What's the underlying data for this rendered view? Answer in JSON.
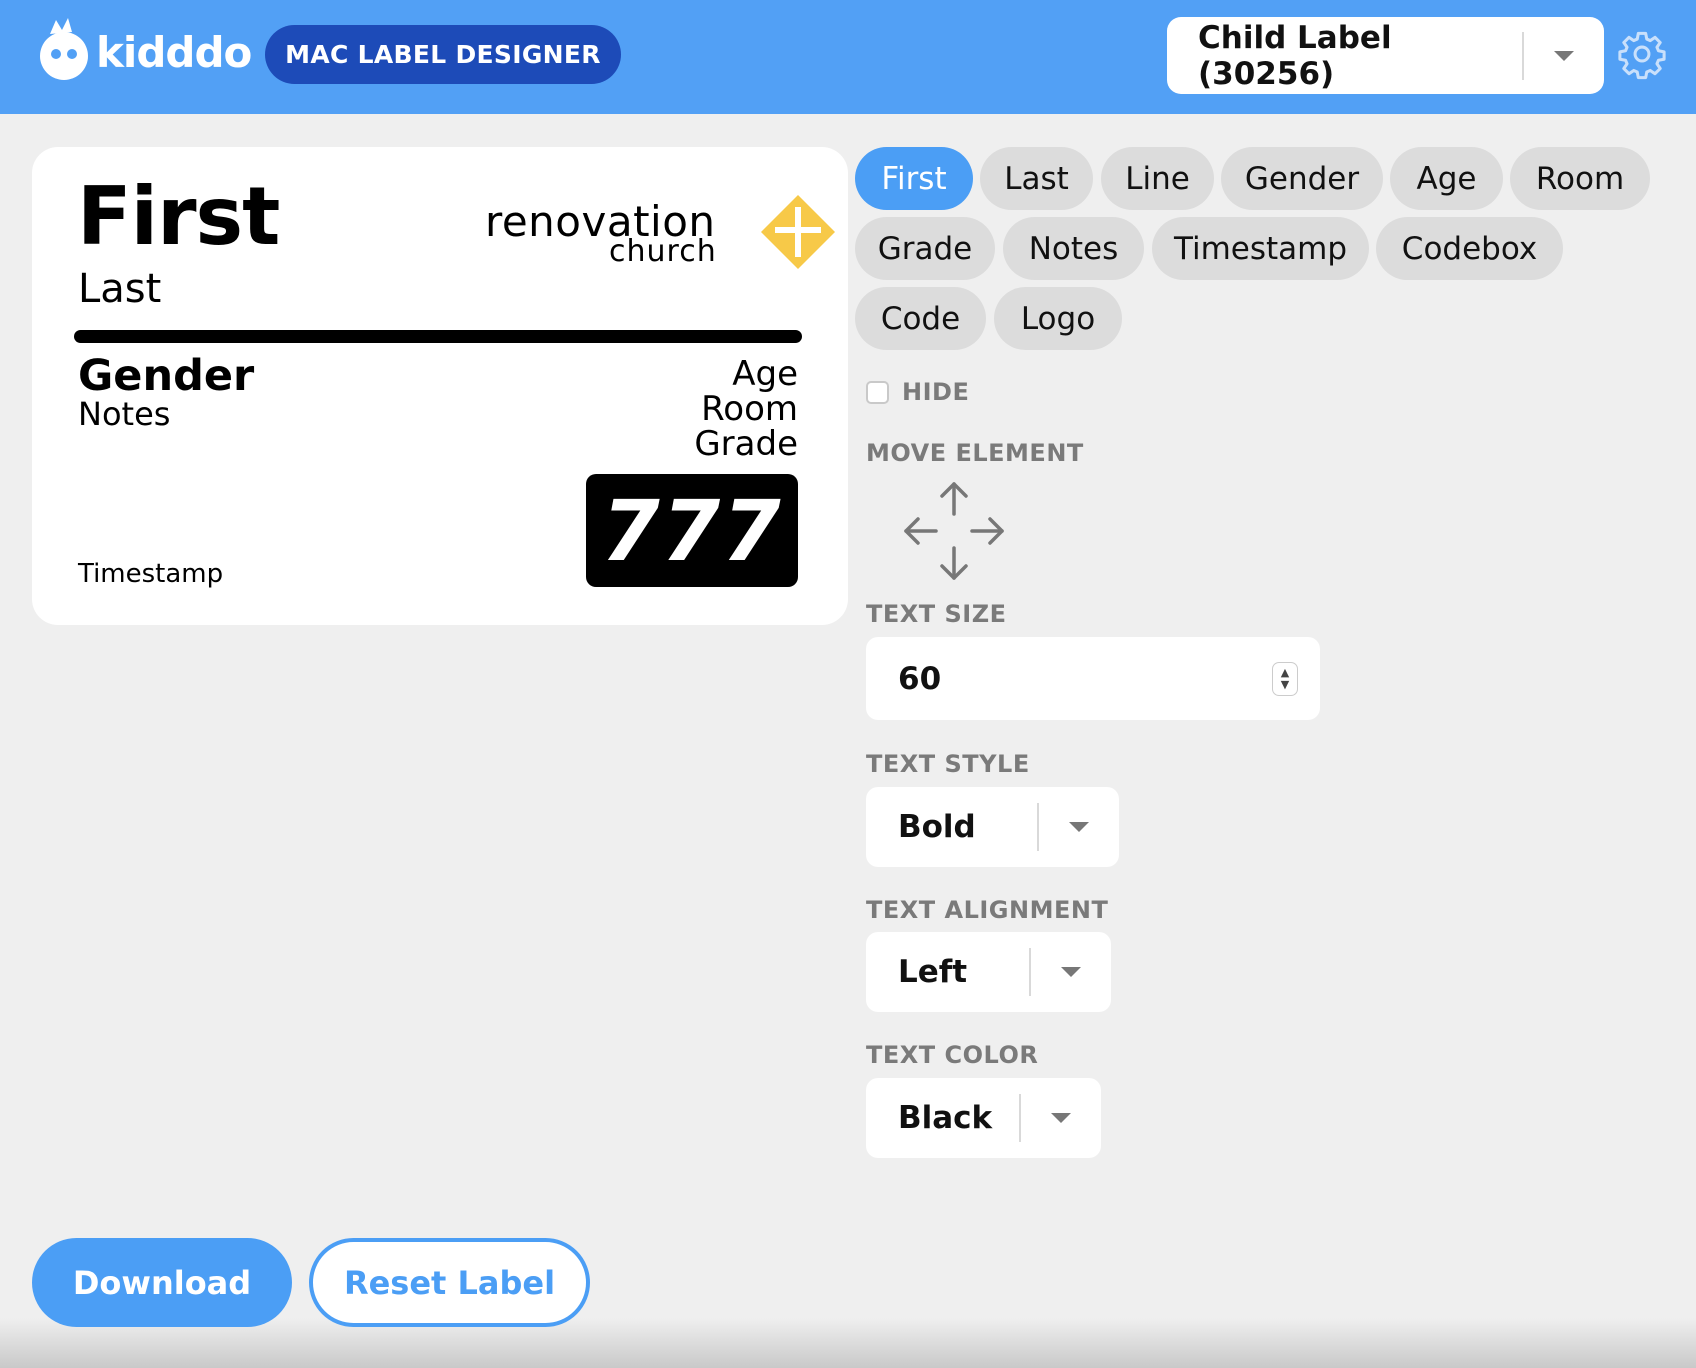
{
  "colors": {
    "header_bg": "#52a0f5",
    "accent": "#4b9ef5",
    "app_pill": "#1d4bb8",
    "page_bg": "#efefef",
    "logo_yellow": "#f7c948"
  },
  "header": {
    "brand": "kidddo",
    "app_name": "MAC LABEL DESIGNER",
    "label_type": {
      "selected": "Child Label (30256)"
    },
    "settings_icon": "gear-icon"
  },
  "label_preview": {
    "first": "First",
    "last": "Last",
    "gender": "Gender",
    "notes": "Notes",
    "age": "Age",
    "room": "Room",
    "grade": "Grade",
    "code": "777",
    "timestamp": "Timestamp",
    "logo": {
      "line1": "renovation",
      "line2": "church"
    }
  },
  "elements": [
    {
      "label": "First",
      "active": true
    },
    {
      "label": "Last",
      "active": false
    },
    {
      "label": "Line",
      "active": false
    },
    {
      "label": "Gender",
      "active": false
    },
    {
      "label": "Age",
      "active": false
    },
    {
      "label": "Room",
      "active": false
    },
    {
      "label": "Grade",
      "active": false
    },
    {
      "label": "Notes",
      "active": false
    },
    {
      "label": "Timestamp",
      "active": false
    },
    {
      "label": "Codebox",
      "active": false
    },
    {
      "label": "Code",
      "active": false
    },
    {
      "label": "Logo",
      "active": false
    }
  ],
  "controls": {
    "hide_label": "HIDE",
    "hide_checked": false,
    "move_label": "MOVE ELEMENT",
    "text_size_label": "TEXT SIZE",
    "text_size_value": "60",
    "text_style_label": "TEXT STYLE",
    "text_style_value": "Bold",
    "text_alignment_label": "TEXT ALIGNMENT",
    "text_alignment_value": "Left",
    "text_color_label": "TEXT COLOR",
    "text_color_value": "Black"
  },
  "actions": {
    "download": "Download",
    "reset": "Reset Label"
  }
}
